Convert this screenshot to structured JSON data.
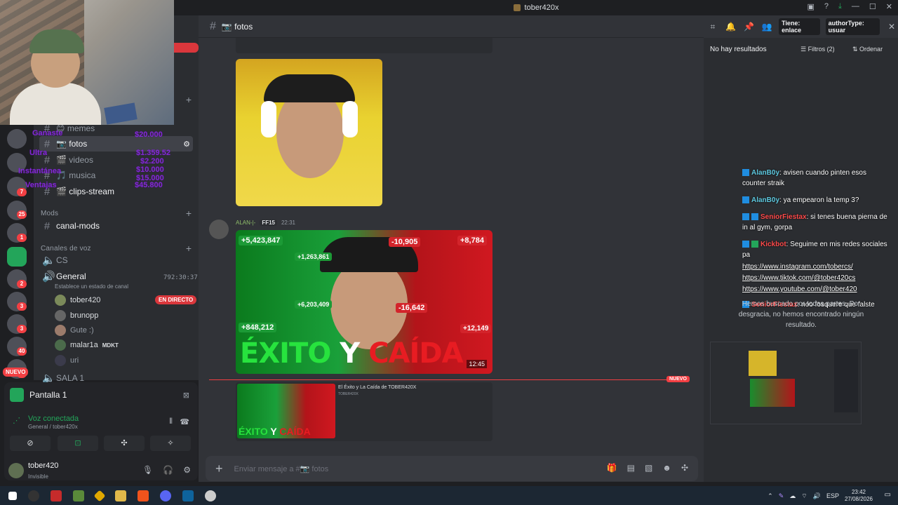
{
  "window": {
    "title": "tober420x"
  },
  "channel_header": {
    "name": "📷 fotos"
  },
  "search_tags": {
    "tag1": "Tiene: enlace",
    "tag2": "authorType: usuar"
  },
  "sidebar": {
    "channels": [
      {
        "label": "😊 memes"
      },
      {
        "label": "📷 fotos"
      },
      {
        "label": "🎬 videos"
      },
      {
        "label": "🎵 musica"
      },
      {
        "label": "🎬 clips-stream"
      }
    ],
    "mods_category": "Mods",
    "mods_channel": "canal-mods",
    "voice_category": "Canales de voz",
    "voice_channels": [
      "CS",
      "General",
      "SALA 1"
    ],
    "general_status": "Establece un estado de canal",
    "general_timer": "792:30:37",
    "voice_users": [
      "tober420",
      "brunopp",
      "Gute :)",
      "malar1a",
      "uri"
    ],
    "malar1a_tag": "MDKT",
    "live_badge": "EN DIRECTO"
  },
  "overlay_text": [
    "Ganaste",
    "$20.000",
    "Ultra",
    "$1.359.52",
    "$2.200",
    "$10.000",
    "Instantánea",
    "$15.000",
    "$45.800",
    "Ventajas"
  ],
  "rail": {
    "badges": [
      "7",
      "25",
      "1",
      "2",
      "3",
      "3",
      "40",
      "3"
    ],
    "nuevo": "NUEVO"
  },
  "voice_panel": {
    "title": "Pantalla 1",
    "connected": "Voz conectada",
    "subtitle": "General / tober420x"
  },
  "user": {
    "name": "tober420",
    "status": "Invisible"
  },
  "message": {
    "author": "ALAN-|-",
    "tag": "FF15",
    "time": "22:31"
  },
  "thumbnail": {
    "title_part1": "ÉXITO",
    "title_part2": "Y",
    "title_part3": "CAÍDA",
    "duration": "12:45",
    "stats": [
      "+5,423,847",
      "+1,263,861",
      "-10,905",
      "+8,784",
      "+6,203,409",
      "-16,642",
      "+848,212",
      "+12,149"
    ]
  },
  "new_divider": "NUEVO",
  "embed": {
    "title": "El Éxito y La Caída de TOBER420X",
    "sub": "TOBER420X"
  },
  "compose": {
    "placeholder": "Enviar mensaje a #📷 fotos"
  },
  "search_panel": {
    "no_results": "No hay resultados",
    "filters": "Filtros (2)",
    "sort": "Ordenar",
    "not_found": "Hemos buscado por todas partes. Por desgracia, no hemos encontrado ningún resultado."
  },
  "stream_chat": [
    {
      "user": "AlanB0y",
      "text": "avisen cuando pinten esos counter straik"
    },
    {
      "user": "AlanB0y",
      "text": "ya empearon la temp 3?"
    },
    {
      "user": "SeniorFiestax",
      "text": "si tenes buena pierna de in al gym, gorpa"
    },
    {
      "user": "Kickbot",
      "text": "Seguime en mis redes sociales pa"
    },
    {
      "user": "",
      "text": "https://www.instagram.com/tobercs/"
    },
    {
      "user": "",
      "text": "https://www.tiktok.com/@tober420cs"
    },
    {
      "user": "",
      "text": "https://www.youtube.com/@tober420"
    },
    {
      "user": "SeniorFiestax",
      "text": "noo fosquere que falste"
    }
  ],
  "taskbar": {
    "lang": "ESP",
    "time": "23:42",
    "date": "27/08/2026"
  }
}
